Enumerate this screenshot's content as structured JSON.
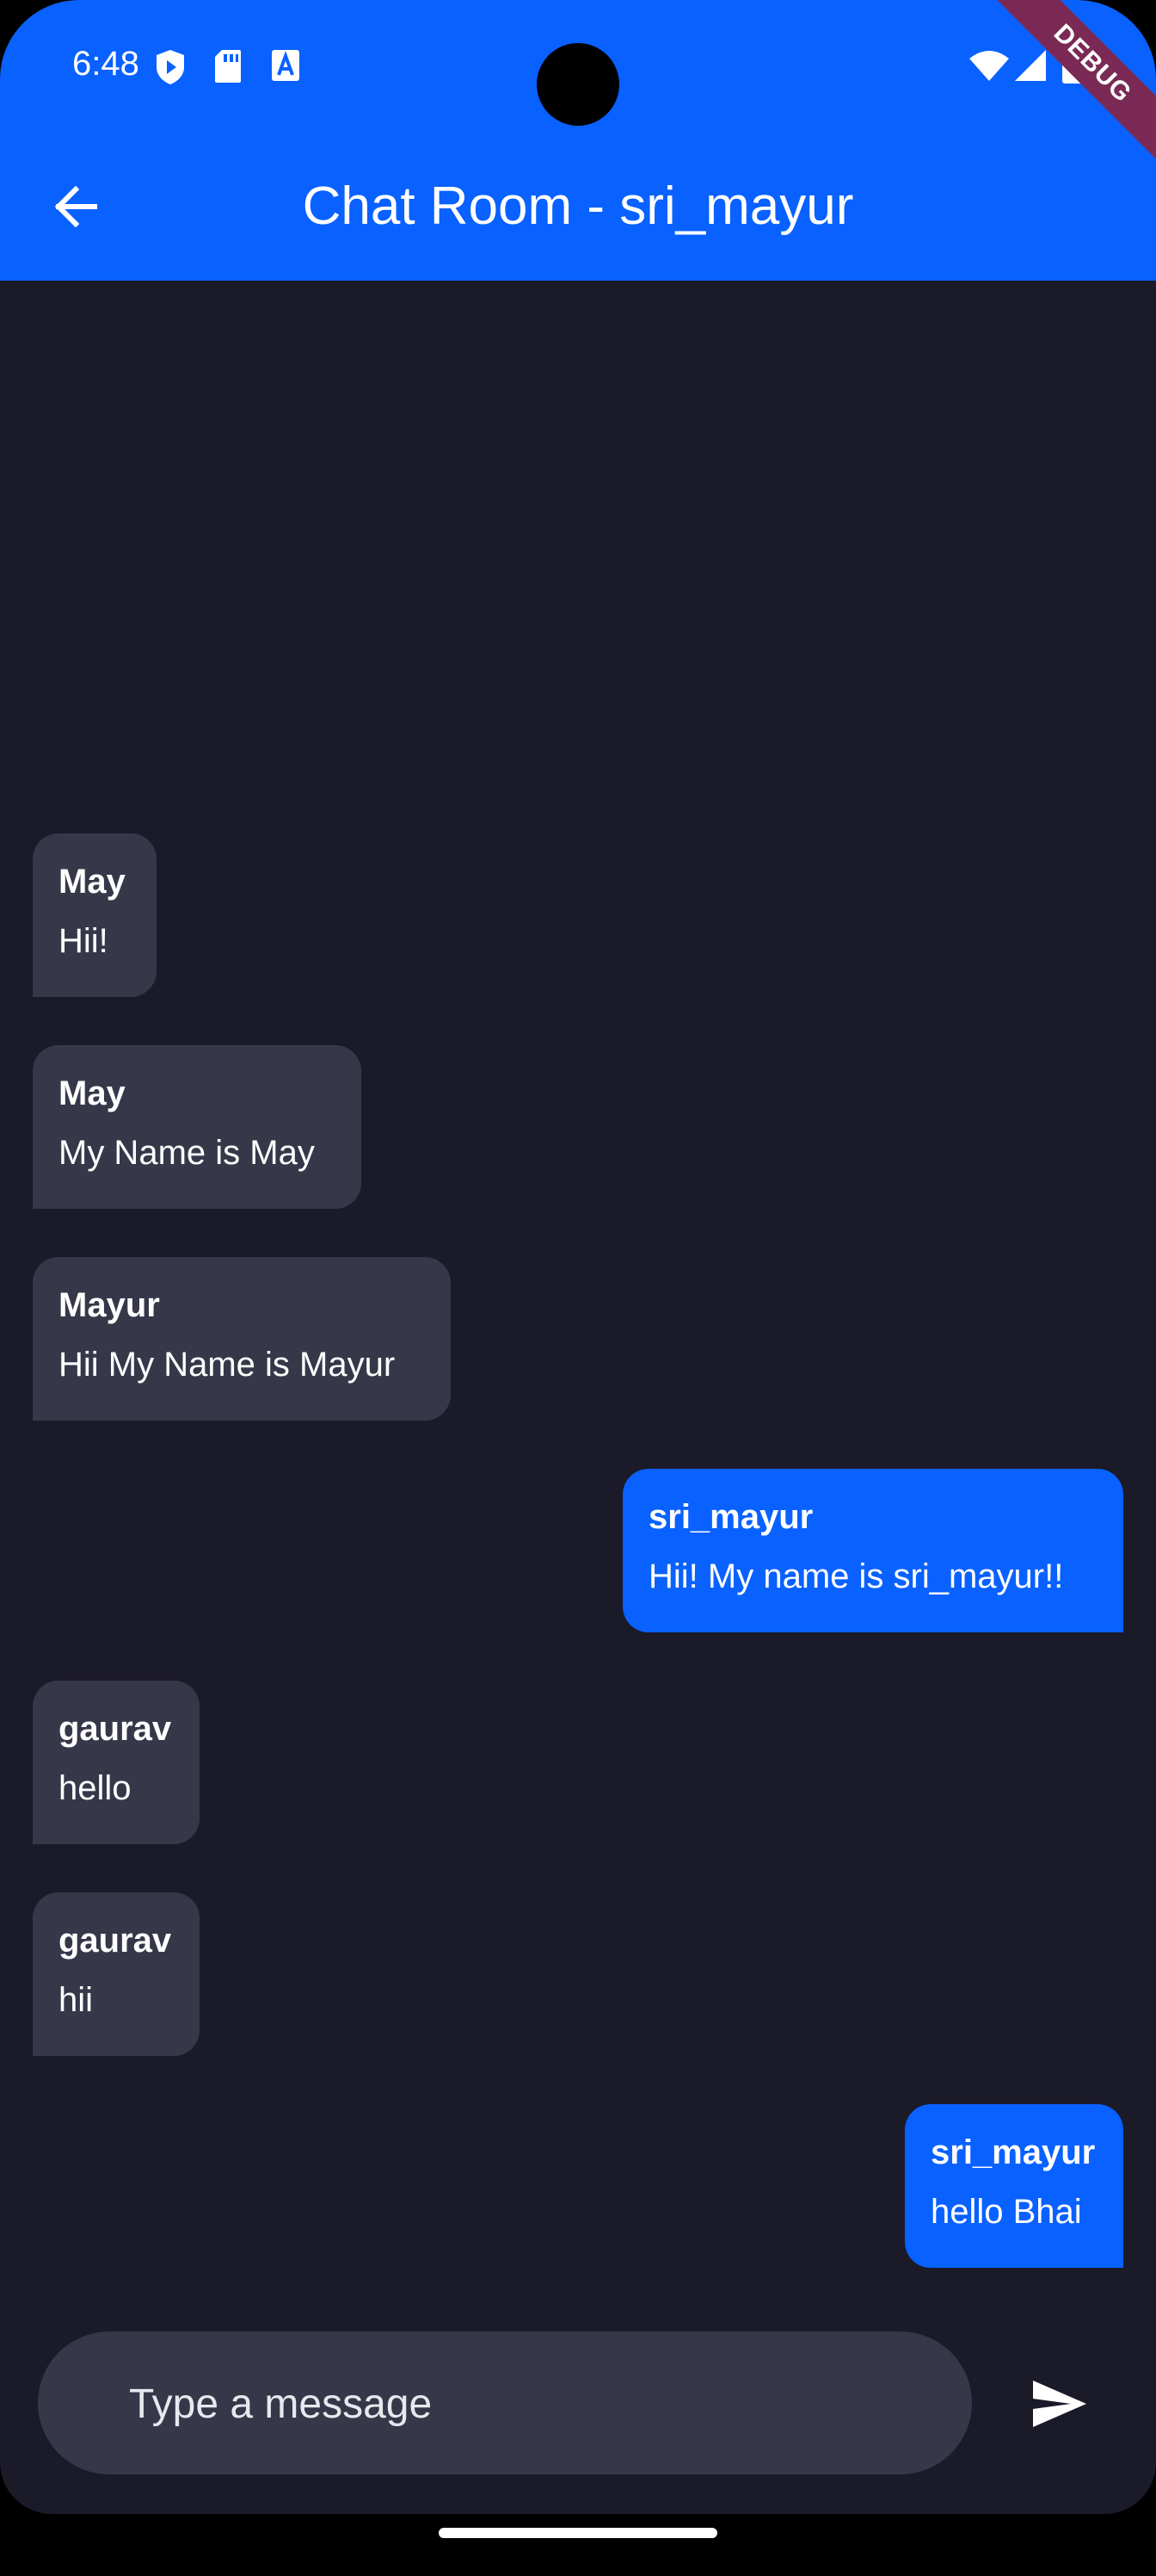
{
  "status_bar": {
    "time": "6:48",
    "icons_left": [
      "shield-play-icon",
      "sd-card-icon",
      "text-a-icon"
    ],
    "icons_right": [
      "wifi-icon",
      "signal-icon",
      "battery-icon"
    ],
    "debug_banner": "DEBUG"
  },
  "colors": {
    "app_bar": "#0961ff",
    "background": "#1b1a28",
    "bubble_other": "#363849",
    "bubble_me": "#0961ff"
  },
  "app_bar": {
    "title": "Chat Room - sri_mayur",
    "back_icon": "arrow-left-icon"
  },
  "messages": [
    {
      "sender": "May",
      "text": "Hii!",
      "mine": false
    },
    {
      "sender": "May",
      "text": "My Name is May",
      "mine": false
    },
    {
      "sender": "Mayur",
      "text": "Hii My Name is Mayur",
      "mine": false
    },
    {
      "sender": "sri_mayur",
      "text": "Hii! My name is sri_mayur!!",
      "mine": true
    },
    {
      "sender": "gaurav",
      "text": "hello",
      "mine": false
    },
    {
      "sender": "gaurav",
      "text": "hii",
      "mine": false
    },
    {
      "sender": "sri_mayur",
      "text": "hello Bhai",
      "mine": true
    }
  ],
  "composer": {
    "placeholder": "Type a message",
    "value": "",
    "send_icon": "send-icon"
  }
}
